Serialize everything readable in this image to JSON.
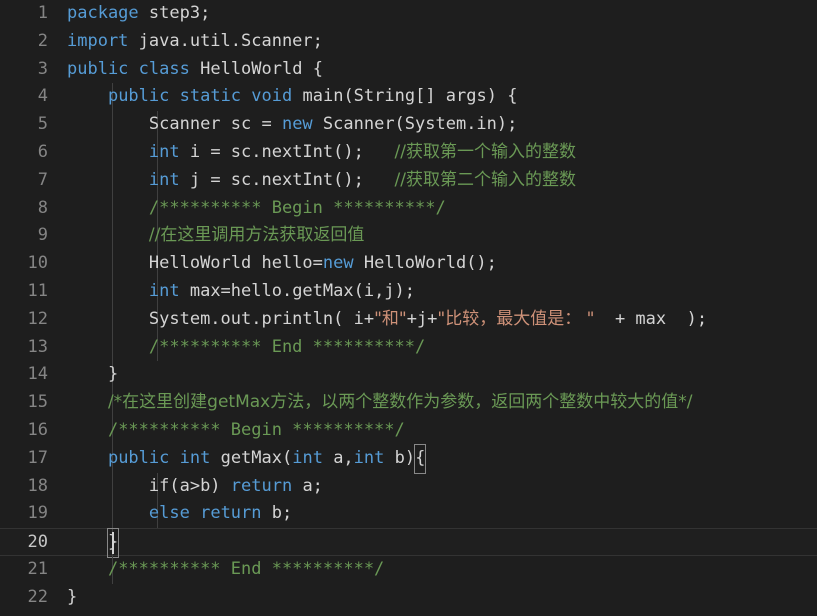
{
  "editor": {
    "language": "java",
    "theme": "dark-plus",
    "active_line": 20,
    "total_lines": 22,
    "colors": {
      "background": "#1e1e1e",
      "active_line_background": "#1f1f1f",
      "active_line_border": "#333333",
      "gutter_text": "#858585",
      "gutter_text_active": "#c6c6c6",
      "default_text": "#d4d4d4",
      "keyword": "#569cd6",
      "comment": "#6a9955",
      "string": "#ce9178",
      "indent_guide": "#404040",
      "bracket_match_outline": "#888888"
    }
  },
  "line_numbers": [
    "1",
    "2",
    "3",
    "4",
    "5",
    "6",
    "7",
    "8",
    "9",
    "10",
    "11",
    "12",
    "13",
    "14",
    "15",
    "16",
    "17",
    "18",
    "19",
    "20",
    "21",
    "22"
  ],
  "code_lines": [
    {
      "n": 1,
      "text": "package step3;"
    },
    {
      "n": 2,
      "text": "import java.util.Scanner;"
    },
    {
      "n": 3,
      "text": "public class HelloWorld {"
    },
    {
      "n": 4,
      "text": "    public static void main(String[] args) {"
    },
    {
      "n": 5,
      "text": "        Scanner sc = new Scanner(System.in);"
    },
    {
      "n": 6,
      "text": "        int i = sc.nextInt();   //获取第一个输入的整数"
    },
    {
      "n": 7,
      "text": "        int j = sc.nextInt();   //获取第二个输入的整数"
    },
    {
      "n": 8,
      "text": "        /********** Begin **********/"
    },
    {
      "n": 9,
      "text": "        //在这里调用方法获取返回值"
    },
    {
      "n": 10,
      "text": "        HelloWorld hello=new HelloWorld();"
    },
    {
      "n": 11,
      "text": "        int max=hello.getMax(i,j);"
    },
    {
      "n": 12,
      "text": "        System.out.println( i+\"和\"+j+\"比较，最大值是： \"  + max  );"
    },
    {
      "n": 13,
      "text": "        /********** End **********/"
    },
    {
      "n": 14,
      "text": "    }"
    },
    {
      "n": 15,
      "text": "    /*在这里创建getMax方法，以两个整数作为参数，返回两个整数中较大的值*/"
    },
    {
      "n": 16,
      "text": "    /********** Begin **********/"
    },
    {
      "n": 17,
      "text": "    public int getMax(int a,int b){"
    },
    {
      "n": 18,
      "text": "        if(a>b) return a;"
    },
    {
      "n": 19,
      "text": "        else return b;"
    },
    {
      "n": 20,
      "text": "    }"
    },
    {
      "n": 21,
      "text": "    /********** End **********/"
    },
    {
      "n": 22,
      "text": "}"
    }
  ],
  "tokens": {
    "l1": {
      "kw": "package",
      "rest": " step3;"
    },
    "l2": {
      "kw": "import",
      "rest": " java.util.Scanner;"
    },
    "l3": {
      "kw1": "public",
      "kw2": "class",
      "name": "HelloWorld",
      "brace": "{"
    },
    "l4": {
      "indent": "    ",
      "kw1": "public",
      "kw2": "static",
      "kw3": "void",
      "rest": "main(String[] args) {"
    },
    "l5": {
      "indent": "        ",
      "pre": "Scanner sc = ",
      "kw": "new",
      "rest": " Scanner(System.in);"
    },
    "l6": {
      "indent": "        ",
      "kw": "int",
      "mid": " i = sc.nextInt();   ",
      "comment": "//获取第一个输入的整数"
    },
    "l7": {
      "indent": "        ",
      "kw": "int",
      "mid": " j = sc.nextInt();   ",
      "comment": "//获取第二个输入的整数"
    },
    "l8": {
      "indent": "        ",
      "comment": "/********** Begin **********/"
    },
    "l9": {
      "indent": "        ",
      "comment": "//在这里调用方法获取返回值"
    },
    "l10": {
      "indent": "        ",
      "pre": "HelloWorld hello=",
      "kw": "new",
      "rest": " HelloWorld();"
    },
    "l11": {
      "indent": "        ",
      "kw": "int",
      "rest": " max=hello.getMax(i,j);"
    },
    "l12": {
      "indent": "        ",
      "pre": "System.out.println( i+",
      "s1": "\"和\"",
      "mid1": "+j+",
      "s2": "\"比较，最大值是： \"",
      "post": "  + max  );"
    },
    "l13": {
      "indent": "        ",
      "comment": "/********** End **********/"
    },
    "l14": {
      "indent": "    ",
      "brace": "}"
    },
    "l15": {
      "indent": "    ",
      "comment": "/*在这里创建getMax方法，以两个整数作为参数，返回两个整数中较大的值*/"
    },
    "l16": {
      "indent": "    ",
      "comment": "/********** Begin **********/"
    },
    "l17": {
      "indent": "    ",
      "kw1": "public",
      "kw2": "int",
      "name": " getMax(",
      "kw3": "int",
      "mid": " a,",
      "kw4": "int",
      "post": " b)",
      "brace": "{"
    },
    "l18": {
      "indent": "        ",
      "pre": "if(a>b) ",
      "kw": "return",
      "rest": " a;"
    },
    "l19": {
      "indent": "        ",
      "kw1": "else",
      "kw2": "return",
      "rest": " b;"
    },
    "l20": {
      "indent": "    ",
      "brace": "}"
    },
    "l21": {
      "indent": "    ",
      "comment": "/********** End **********/"
    },
    "l22": {
      "brace": "}"
    }
  }
}
